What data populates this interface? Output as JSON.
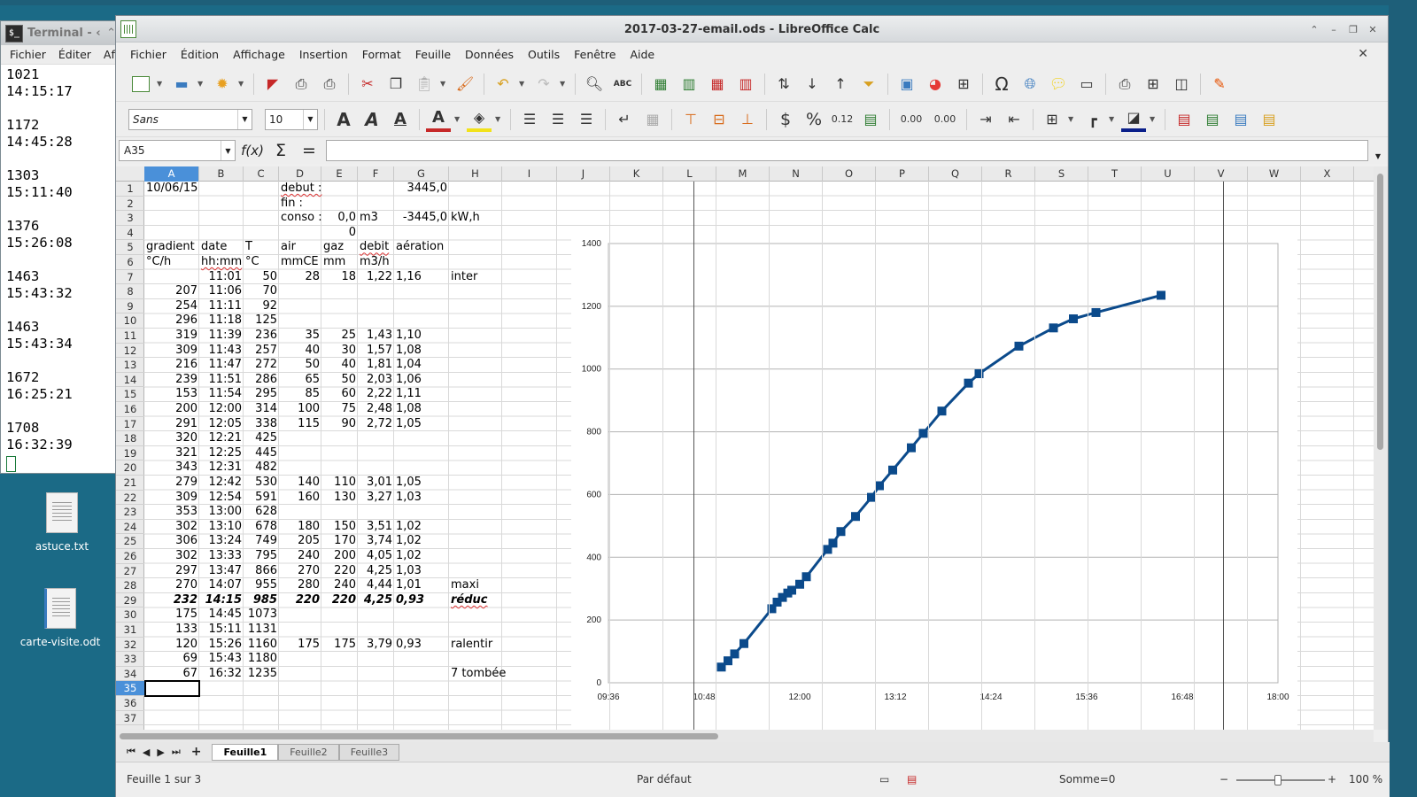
{
  "terminal": {
    "title": "Terminal - ‹",
    "menu": [
      "Fichier",
      "Éditer",
      "Affi"
    ],
    "entries": [
      {
        "value": "1021",
        "time": "14:15:17"
      },
      {
        "value": "1172",
        "time": "14:45:28"
      },
      {
        "value": "1303",
        "time": "15:11:40"
      },
      {
        "value": "1376",
        "time": "15:26:08"
      },
      {
        "value": "1463",
        "time": "15:43:32"
      },
      {
        "value": "1463",
        "time": "15:43:34"
      },
      {
        "value": "1672",
        "time": "16:25:21"
      },
      {
        "value": "1708",
        "time": "16:32:39"
      }
    ]
  },
  "desktop": {
    "icons": [
      {
        "label": "astuce.txt",
        "icon": "text-file-icon"
      },
      {
        "label": "carte-visite.odt",
        "icon": "writer-document-icon"
      }
    ]
  },
  "window": {
    "title": "2017-03-27-email.ods - LibreOffice Calc",
    "menu": [
      "Fichier",
      "Édition",
      "Affichage",
      "Insertion",
      "Format",
      "Feuille",
      "Données",
      "Outils",
      "Fenêtre",
      "Aide"
    ]
  },
  "format_toolbar": {
    "font_name": "Sans",
    "font_size": "10",
    "currency_label": "$",
    "percent_label": "%",
    "number_label": "0.12",
    "add_decimal_label": "0.00",
    "del_decimal_label": "0.00"
  },
  "formula_bar": {
    "name_box": "A35",
    "fx_label": "f(x)",
    "sum_label": "Σ",
    "equals_label": "=",
    "content": ""
  },
  "grid": {
    "columns": [
      "A",
      "B",
      "C",
      "D",
      "E",
      "F",
      "G",
      "H",
      "I",
      "J",
      "K",
      "L",
      "M",
      "N",
      "O",
      "P",
      "Q",
      "R",
      "S",
      "T",
      "U",
      "V",
      "W",
      "X"
    ],
    "rows": [
      "1",
      "2",
      "3",
      "4",
      "5",
      "6",
      "7",
      "8",
      "9",
      "10",
      "11",
      "12",
      "13",
      "14",
      "15",
      "16",
      "17",
      "18",
      "19",
      "20",
      "21",
      "22",
      "23",
      "24",
      "25",
      "26",
      "27",
      "28",
      "29",
      "30",
      "31",
      "32",
      "33",
      "34",
      "35",
      "36",
      "37"
    ],
    "selected_cell": "A35",
    "header_cells": {
      "a1": "10/06/15",
      "d1": "debut :",
      "g1": "3445,0",
      "d2": "fin :",
      "d3": "conso :",
      "e3": "0,0",
      "f3": "m3",
      "g3": "-3445,0",
      "h3": "kW,h",
      "e4": "0",
      "a5": "gradient",
      "b5": "date",
      "c5": "T",
      "d5": "air",
      "e5": "gaz",
      "f5": "debit",
      "g5": "aération",
      "a6": "°C/h",
      "b6": "hh:mm",
      "c6": "°C",
      "d6": "mmCE",
      "e6": "mm",
      "f6": "m3/h"
    },
    "data_rows": [
      {
        "row": 7,
        "a": "",
        "b": "11:01",
        "c": "50",
        "d": "28",
        "e": "18",
        "f": "1,22",
        "g": "1,16",
        "h": "inter",
        "bold": false
      },
      {
        "row": 8,
        "a": "207",
        "b": "11:06",
        "c": "70",
        "d": "",
        "e": "",
        "f": "",
        "g": "",
        "h": "",
        "bold": false
      },
      {
        "row": 9,
        "a": "254",
        "b": "11:11",
        "c": "92",
        "d": "",
        "e": "",
        "f": "",
        "g": "",
        "h": "",
        "bold": false
      },
      {
        "row": 10,
        "a": "296",
        "b": "11:18",
        "c": "125",
        "d": "",
        "e": "",
        "f": "",
        "g": "",
        "h": "",
        "bold": false
      },
      {
        "row": 11,
        "a": "319",
        "b": "11:39",
        "c": "236",
        "d": "35",
        "e": "25",
        "f": "1,43",
        "g": "1,10",
        "h": "",
        "bold": false
      },
      {
        "row": 12,
        "a": "309",
        "b": "11:43",
        "c": "257",
        "d": "40",
        "e": "30",
        "f": "1,57",
        "g": "1,08",
        "h": "",
        "bold": false
      },
      {
        "row": 13,
        "a": "216",
        "b": "11:47",
        "c": "272",
        "d": "50",
        "e": "40",
        "f": "1,81",
        "g": "1,04",
        "h": "",
        "bold": false
      },
      {
        "row": 14,
        "a": "239",
        "b": "11:51",
        "c": "286",
        "d": "65",
        "e": "50",
        "f": "2,03",
        "g": "1,06",
        "h": "",
        "bold": false
      },
      {
        "row": 15,
        "a": "153",
        "b": "11:54",
        "c": "295",
        "d": "85",
        "e": "60",
        "f": "2,22",
        "g": "1,11",
        "h": "",
        "bold": false
      },
      {
        "row": 16,
        "a": "200",
        "b": "12:00",
        "c": "314",
        "d": "100",
        "e": "75",
        "f": "2,48",
        "g": "1,08",
        "h": "",
        "bold": false
      },
      {
        "row": 17,
        "a": "291",
        "b": "12:05",
        "c": "338",
        "d": "115",
        "e": "90",
        "f": "2,72",
        "g": "1,05",
        "h": "",
        "bold": false
      },
      {
        "row": 18,
        "a": "320",
        "b": "12:21",
        "c": "425",
        "d": "",
        "e": "",
        "f": "",
        "g": "",
        "h": "",
        "bold": false
      },
      {
        "row": 19,
        "a": "321",
        "b": "12:25",
        "c": "445",
        "d": "",
        "e": "",
        "f": "",
        "g": "",
        "h": "",
        "bold": false
      },
      {
        "row": 20,
        "a": "343",
        "b": "12:31",
        "c": "482",
        "d": "",
        "e": "",
        "f": "",
        "g": "",
        "h": "",
        "bold": false
      },
      {
        "row": 21,
        "a": "279",
        "b": "12:42",
        "c": "530",
        "d": "140",
        "e": "110",
        "f": "3,01",
        "g": "1,05",
        "h": "",
        "bold": false
      },
      {
        "row": 22,
        "a": "309",
        "b": "12:54",
        "c": "591",
        "d": "160",
        "e": "130",
        "f": "3,27",
        "g": "1,03",
        "h": "",
        "bold": false
      },
      {
        "row": 23,
        "a": "353",
        "b": "13:00",
        "c": "628",
        "d": "",
        "e": "",
        "f": "",
        "g": "",
        "h": "",
        "bold": false
      },
      {
        "row": 24,
        "a": "302",
        "b": "13:10",
        "c": "678",
        "d": "180",
        "e": "150",
        "f": "3,51",
        "g": "1,02",
        "h": "",
        "bold": false
      },
      {
        "row": 25,
        "a": "306",
        "b": "13:24",
        "c": "749",
        "d": "205",
        "e": "170",
        "f": "3,74",
        "g": "1,02",
        "h": "",
        "bold": false
      },
      {
        "row": 26,
        "a": "302",
        "b": "13:33",
        "c": "795",
        "d": "240",
        "e": "200",
        "f": "4,05",
        "g": "1,02",
        "h": "",
        "bold": false
      },
      {
        "row": 27,
        "a": "297",
        "b": "13:47",
        "c": "866",
        "d": "270",
        "e": "220",
        "f": "4,25",
        "g": "1,03",
        "h": "",
        "bold": false
      },
      {
        "row": 28,
        "a": "270",
        "b": "14:07",
        "c": "955",
        "d": "280",
        "e": "240",
        "f": "4,44",
        "g": "1,01",
        "h": "maxi",
        "bold": false
      },
      {
        "row": 29,
        "a": "232",
        "b": "14:15",
        "c": "985",
        "d": "220",
        "e": "220",
        "f": "4,25",
        "g": "0,93",
        "h": "réduc",
        "bold": true
      },
      {
        "row": 30,
        "a": "175",
        "b": "14:45",
        "c": "1073",
        "d": "",
        "e": "",
        "f": "",
        "g": "",
        "h": "",
        "bold": false
      },
      {
        "row": 31,
        "a": "133",
        "b": "15:11",
        "c": "1131",
        "d": "",
        "e": "",
        "f": "",
        "g": "",
        "h": "",
        "bold": false
      },
      {
        "row": 32,
        "a": "120",
        "b": "15:26",
        "c": "1160",
        "d": "175",
        "e": "175",
        "f": "3,79",
        "g": "0,93",
        "h": "ralentir",
        "bold": false
      },
      {
        "row": 33,
        "a": "69",
        "b": "15:43",
        "c": "1180",
        "d": "",
        "e": "",
        "f": "",
        "g": "",
        "h": "",
        "bold": false
      },
      {
        "row": 34,
        "a": "67",
        "b": "16:32",
        "c": "1235",
        "d": "",
        "e": "",
        "f": "",
        "g": "",
        "h": "7 tombée",
        "bold": false
      }
    ]
  },
  "chart_data": {
    "type": "line",
    "title": "",
    "xlabel": "",
    "ylabel": "",
    "x_ticks": [
      "09:36",
      "10:48",
      "12:00",
      "13:12",
      "14:24",
      "15:36",
      "16:48",
      "18:00"
    ],
    "y_ticks": [
      "0",
      "200",
      "400",
      "600",
      "800",
      "1000",
      "1200",
      "1400"
    ],
    "xlim": [
      "09:36",
      "18:00"
    ],
    "ylim": [
      0,
      1400
    ],
    "grid": true,
    "legend": "none",
    "series": [
      {
        "color": "#0b4a8b",
        "marker": "square",
        "points": [
          {
            "x": "11:01",
            "y": 50
          },
          {
            "x": "11:06",
            "y": 70
          },
          {
            "x": "11:11",
            "y": 92
          },
          {
            "x": "11:18",
            "y": 125
          },
          {
            "x": "11:39",
            "y": 236
          },
          {
            "x": "11:43",
            "y": 257
          },
          {
            "x": "11:47",
            "y": 272
          },
          {
            "x": "11:51",
            "y": 286
          },
          {
            "x": "11:54",
            "y": 295
          },
          {
            "x": "12:00",
            "y": 314
          },
          {
            "x": "12:05",
            "y": 338
          },
          {
            "x": "12:21",
            "y": 425
          },
          {
            "x": "12:25",
            "y": 445
          },
          {
            "x": "12:31",
            "y": 482
          },
          {
            "x": "12:42",
            "y": 530
          },
          {
            "x": "12:54",
            "y": 591
          },
          {
            "x": "13:00",
            "y": 628
          },
          {
            "x": "13:10",
            "y": 678
          },
          {
            "x": "13:24",
            "y": 749
          },
          {
            "x": "13:33",
            "y": 795
          },
          {
            "x": "13:47",
            "y": 866
          },
          {
            "x": "14:07",
            "y": 955
          },
          {
            "x": "14:15",
            "y": 985
          },
          {
            "x": "14:45",
            "y": 1073
          },
          {
            "x": "15:11",
            "y": 1131
          },
          {
            "x": "15:26",
            "y": 1160
          },
          {
            "x": "15:43",
            "y": 1180
          },
          {
            "x": "16:32",
            "y": 1235
          }
        ]
      }
    ]
  },
  "sheet_tabs": [
    "Feuille1",
    "Feuille2",
    "Feuille3"
  ],
  "active_tab": "Feuille1",
  "status": {
    "sheet_info": "Feuille 1 sur 3",
    "page_style": "Par défaut",
    "sum": "Somme=0",
    "zoom": "100 %",
    "zoom_minus": "−",
    "zoom_plus": "+"
  }
}
